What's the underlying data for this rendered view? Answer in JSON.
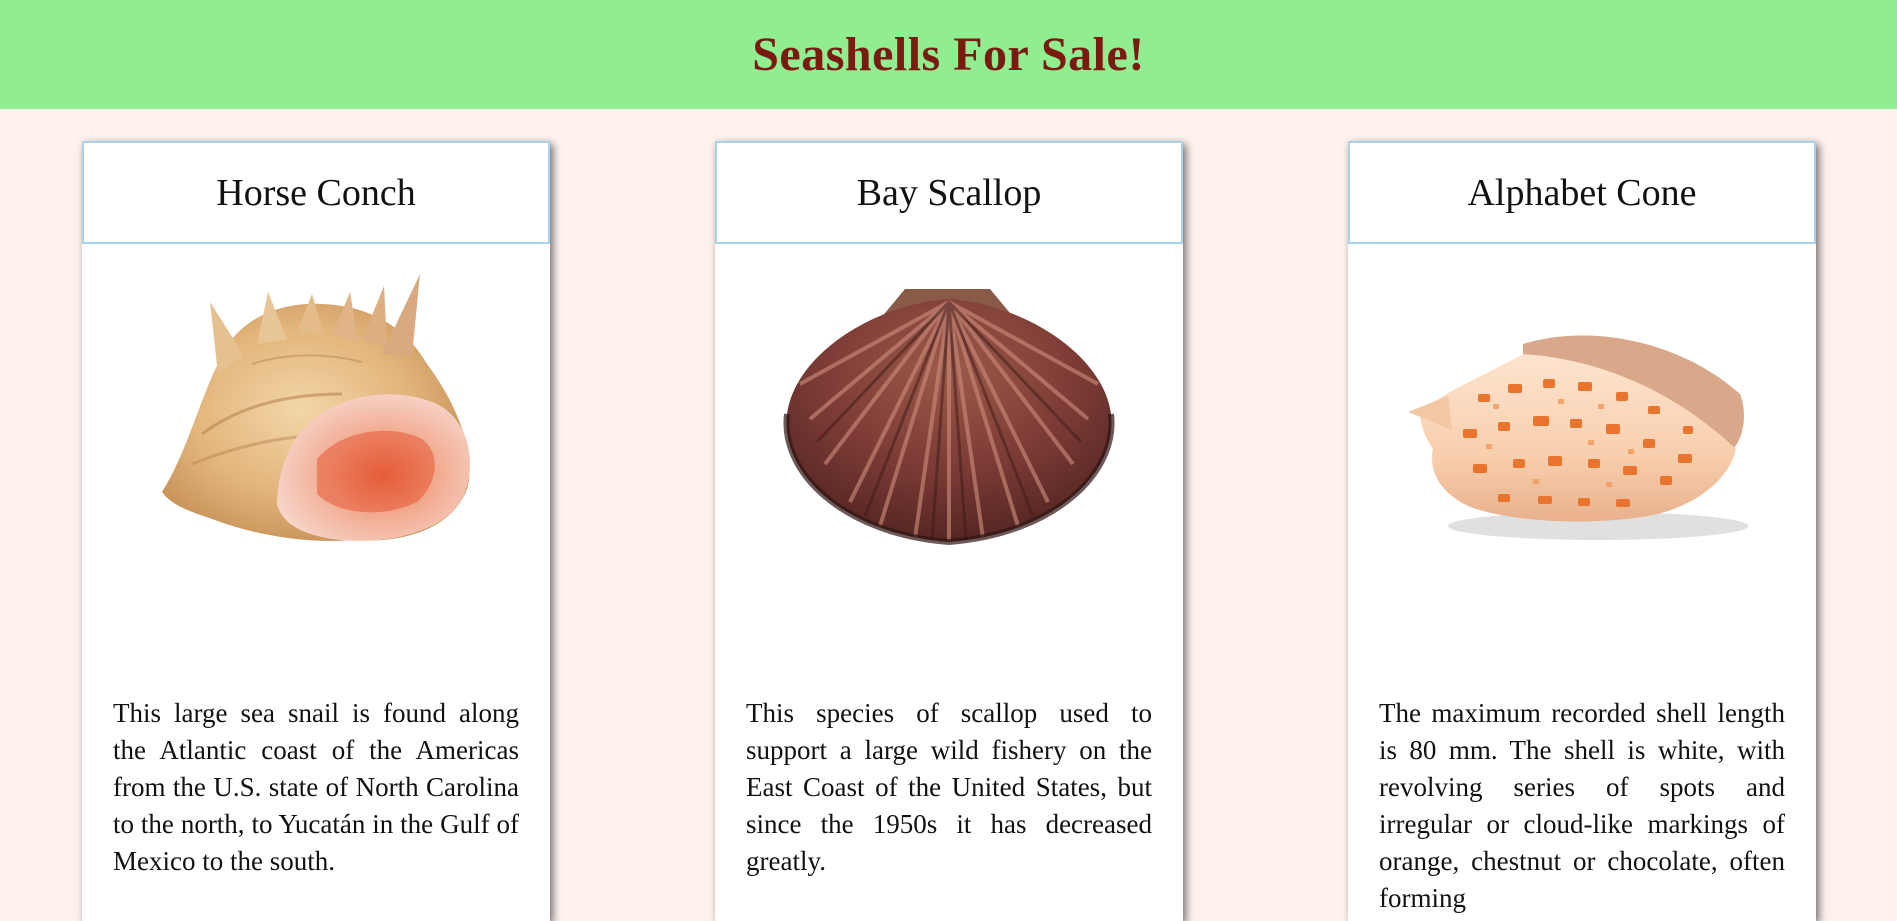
{
  "header": {
    "title": "Seashells For Sale!",
    "background": "#90ee90",
    "title_color": "#7a1a10"
  },
  "cards": [
    {
      "title": "Horse Conch",
      "image_icon": "horse-conch-shell-icon",
      "description": "This large sea snail is found along the Atlantic coast of the Americas from the U.S. state of North Carolina to the north, to Yucatán in the Gulf of Mexico to the south."
    },
    {
      "title": "Bay Scallop",
      "image_icon": "bay-scallop-shell-icon",
      "description": "This species of scallop used to support a large wild fishery on the East Coast of the United States, but since the 1950s it has decreased greatly."
    },
    {
      "title": "Alphabet Cone",
      "image_icon": "alphabet-cone-shell-icon",
      "description": "The maximum recorded shell length is 80 mm. The shell is white, with revolving series of spots and irregular or cloud-like markings of orange, chestnut or chocolate, often forming"
    }
  ],
  "colors": {
    "page_background": "#fdf2ee",
    "card_border": "#a9d3ea"
  }
}
